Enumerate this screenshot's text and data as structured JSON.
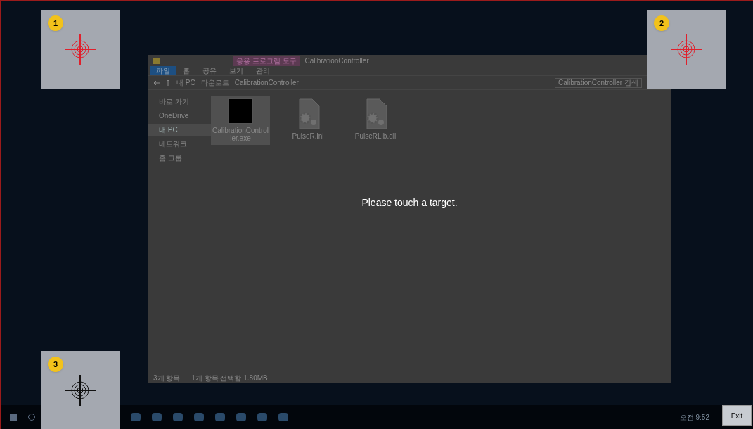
{
  "explorer": {
    "context_tab": "응용 프로그램 도구",
    "title": "CalibrationController",
    "ribbon_tabs": [
      {
        "label": "파일",
        "selected": true
      },
      {
        "label": "홈",
        "selected": false
      },
      {
        "label": "공유",
        "selected": false
      },
      {
        "label": "보기",
        "selected": false
      },
      {
        "label": "관리",
        "selected": false
      }
    ],
    "path": [
      "내 PC",
      "다운로드",
      "CalibrationController"
    ],
    "search": {
      "placeholder": "CalibrationController 검색"
    },
    "sidebar": [
      {
        "label": "바로 가기",
        "selected": false
      },
      {
        "label": "OneDrive",
        "selected": false
      },
      {
        "label": "내 PC",
        "selected": true
      },
      {
        "label": "네트워크",
        "selected": false
      },
      {
        "label": "홈 그룹",
        "selected": false
      }
    ],
    "files": [
      {
        "name": "CalibrationControl ler.exe",
        "kind": "app",
        "selected": true
      },
      {
        "name": "PulseR.ini",
        "kind": "config",
        "selected": false
      },
      {
        "name": "PulseRLib.dll",
        "kind": "library",
        "selected": false
      }
    ],
    "status": [
      "3개 항목",
      "1개 항목 선택함 1.80MB"
    ]
  },
  "prompt": "Please touch a target.",
  "targets": [
    {
      "number": "1",
      "color": "#e0202c"
    },
    {
      "number": "2",
      "color": "#e0202c"
    },
    {
      "number": "3",
      "color": "#111111"
    }
  ],
  "exit_button": "Exit",
  "clock": "오전 9:52"
}
